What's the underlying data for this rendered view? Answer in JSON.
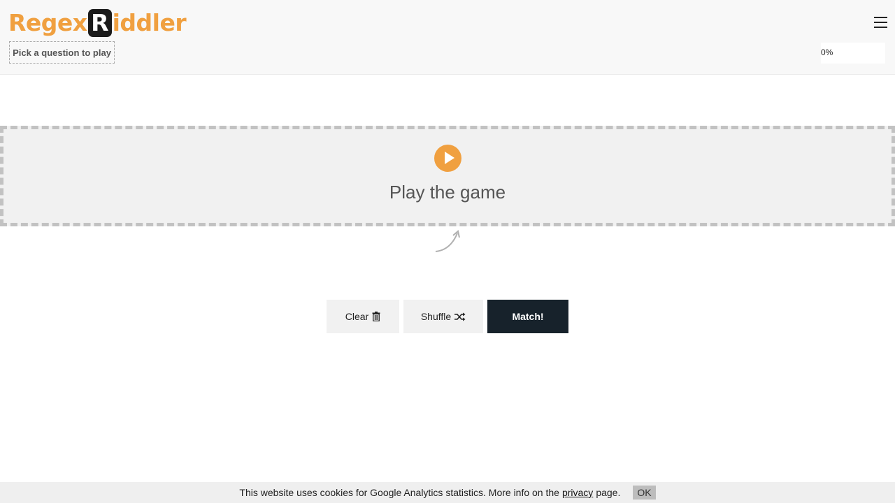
{
  "header": {
    "logo_left": "Regex",
    "logo_badge": "R",
    "logo_right": "iddler",
    "pick_question": "Pick a question to play",
    "progress": {
      "value": 0,
      "label": "0%"
    }
  },
  "play": {
    "label": "Play the game"
  },
  "buttons": {
    "clear": "Clear",
    "shuffle": "Shuffle",
    "match": "Match!"
  },
  "cookie": {
    "text_before": "This website uses cookies for Google Analytics statistics. More info on the",
    "link": "privacy",
    "text_after": "page.",
    "ok": "OK"
  },
  "colors": {
    "accent": "#f0a040",
    "dark": "#17222b",
    "light_gray": "#f1f1f1"
  }
}
